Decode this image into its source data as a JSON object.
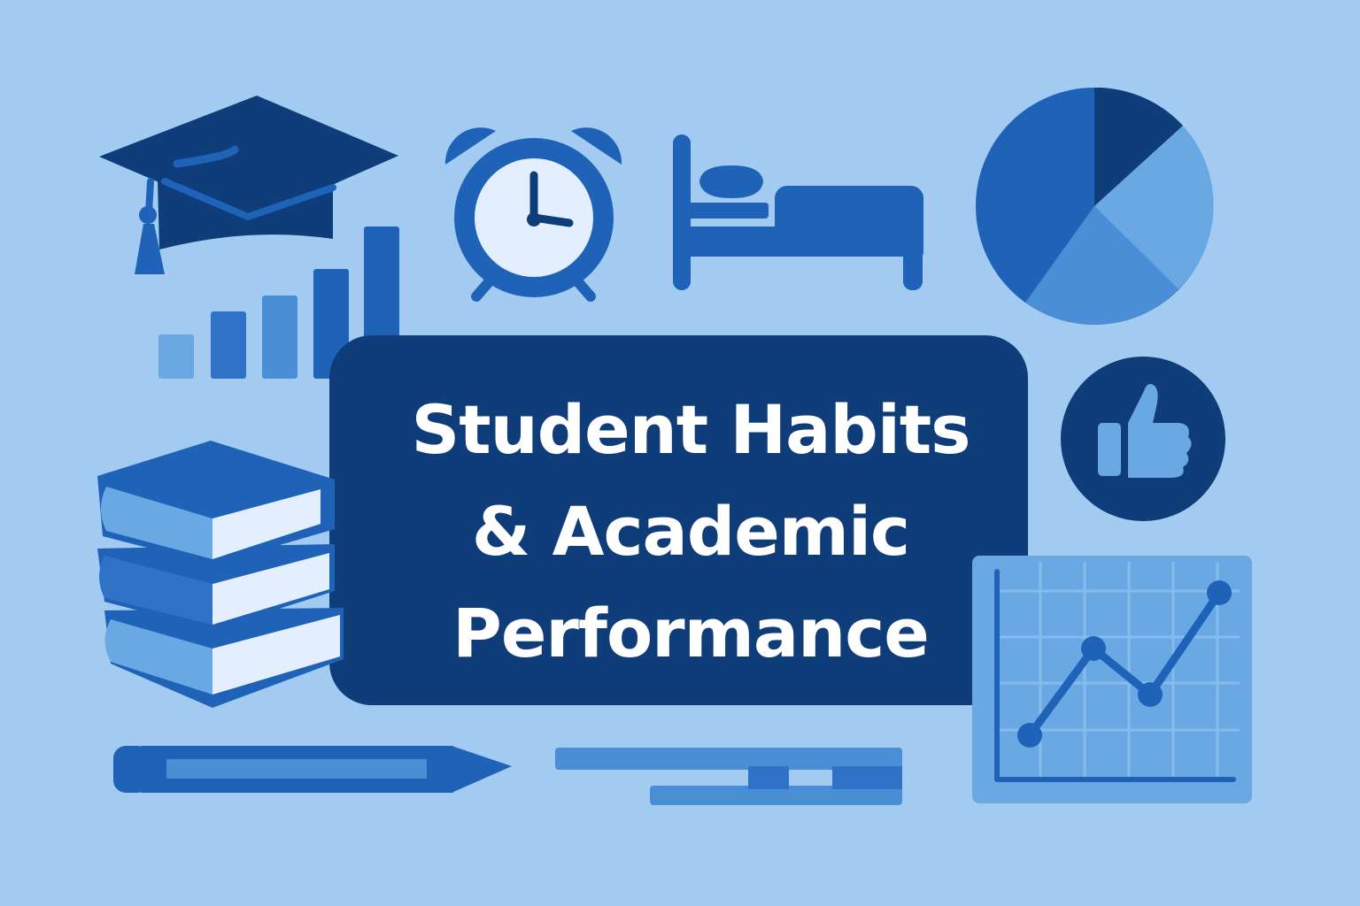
{
  "title": {
    "line1": "Student Habits",
    "line2": "& Academic",
    "line3": "Performance"
  },
  "colors": {
    "background": "#a3cbf1",
    "navy": "#0e3d7a",
    "primary": "#1e63b8",
    "mid": "#4a8fd6",
    "light": "#6aa8e4",
    "pale": "#e3efff"
  },
  "icons": [
    "graduation-cap-icon",
    "alarm-clock-icon",
    "bed-icon",
    "pie-chart-icon",
    "bar-chart-icon",
    "books-stack-icon",
    "thumbs-up-icon",
    "line-chart-icon",
    "pencil-icon",
    "pen-icon"
  ]
}
